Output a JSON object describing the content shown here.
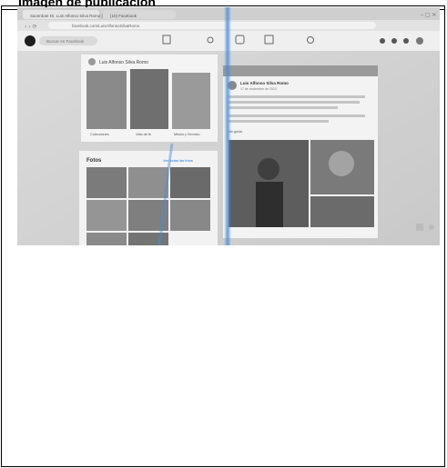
{
  "document": {
    "title": "Imagen de publicación"
  },
  "photo": {
    "browser": {
      "tabs": [
        "Sacerdote Dr. Luis Alfonso Silva Romo | Facebook",
        "(10) Facebook"
      ],
      "url": "facebook.com/LuisAlfonsoSilvaRomo",
      "search_placeholder": "Buscar en Facebook"
    },
    "profile": {
      "name": "Luis Alfonso Silva Romo",
      "highlights": [
        "Colecciones",
        "Vida de fe",
        "Misión y Servicio"
      ]
    },
    "photos_section": {
      "title": "Fotos",
      "link": "Ver todas las fotos"
    },
    "post": {
      "author": "Luis Alfonso Silva Romo",
      "date": "17 de noviembre de 2023",
      "text": "Junto a la Fundación Galería Tabasco, hemos compartido la reunión con amigos y amigas de la colonia...",
      "reactions": "Me gusta"
    },
    "icon_names": [
      "facebook-logo-icon",
      "search-icon",
      "home-icon",
      "friends-icon",
      "video-icon",
      "marketplace-icon",
      "groups-icon",
      "menu-icon",
      "messenger-icon",
      "notifications-icon"
    ],
    "colors": {
      "facebook_blue": "#1877f2",
      "ink_smudge": "#4a8fd8",
      "screen_background": "#e8e8e8"
    }
  }
}
